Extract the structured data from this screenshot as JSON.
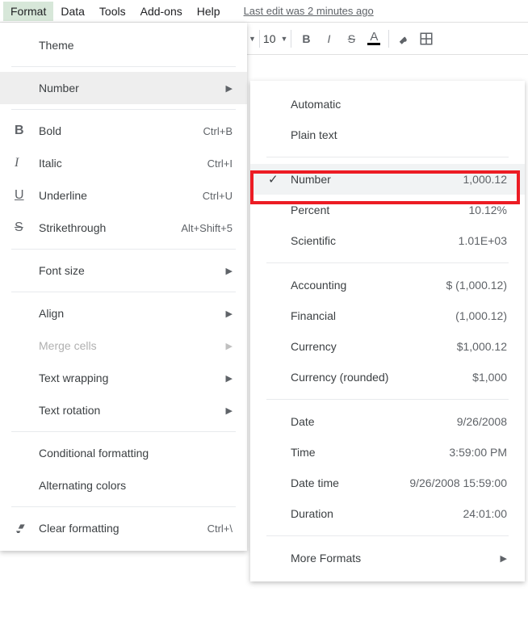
{
  "menubar": {
    "items": [
      "Format",
      "Data",
      "Tools",
      "Add-ons",
      "Help"
    ],
    "active_index": 0,
    "last_edit": "Last edit was 2 minutes ago"
  },
  "toolbar": {
    "font_size": "10"
  },
  "format_menu": {
    "theme": "Theme",
    "number": "Number",
    "bold": "Bold",
    "bold_sc": "Ctrl+B",
    "italic": "Italic",
    "italic_sc": "Ctrl+I",
    "underline": "Underline",
    "underline_sc": "Ctrl+U",
    "strike": "Strikethrough",
    "strike_sc": "Alt+Shift+5",
    "fontsize": "Font size",
    "align": "Align",
    "merge": "Merge cells",
    "wrap": "Text wrapping",
    "rotation": "Text rotation",
    "cond": "Conditional formatting",
    "alt": "Alternating colors",
    "clear": "Clear formatting",
    "clear_sc": "Ctrl+\\"
  },
  "number_menu": {
    "automatic": "Automatic",
    "plain": "Plain text",
    "number": "Number",
    "number_ex": "1,000.12",
    "percent": "Percent",
    "percent_ex": "10.12%",
    "scientific": "Scientific",
    "scientific_ex": "1.01E+03",
    "accounting": "Accounting",
    "accounting_ex": "$ (1,000.12)",
    "financial": "Financial",
    "financial_ex": "(1,000.12)",
    "currency": "Currency",
    "currency_ex": "$1,000.12",
    "curr_round": "Currency (rounded)",
    "curr_round_ex": "$1,000",
    "date": "Date",
    "date_ex": "9/26/2008",
    "time": "Time",
    "time_ex": "3:59:00 PM",
    "datetime": "Date time",
    "datetime_ex": "9/26/2008 15:59:00",
    "duration": "Duration",
    "duration_ex": "24:01:00",
    "more": "More Formats"
  },
  "colors": {
    "highlight": "#ec1c24"
  }
}
